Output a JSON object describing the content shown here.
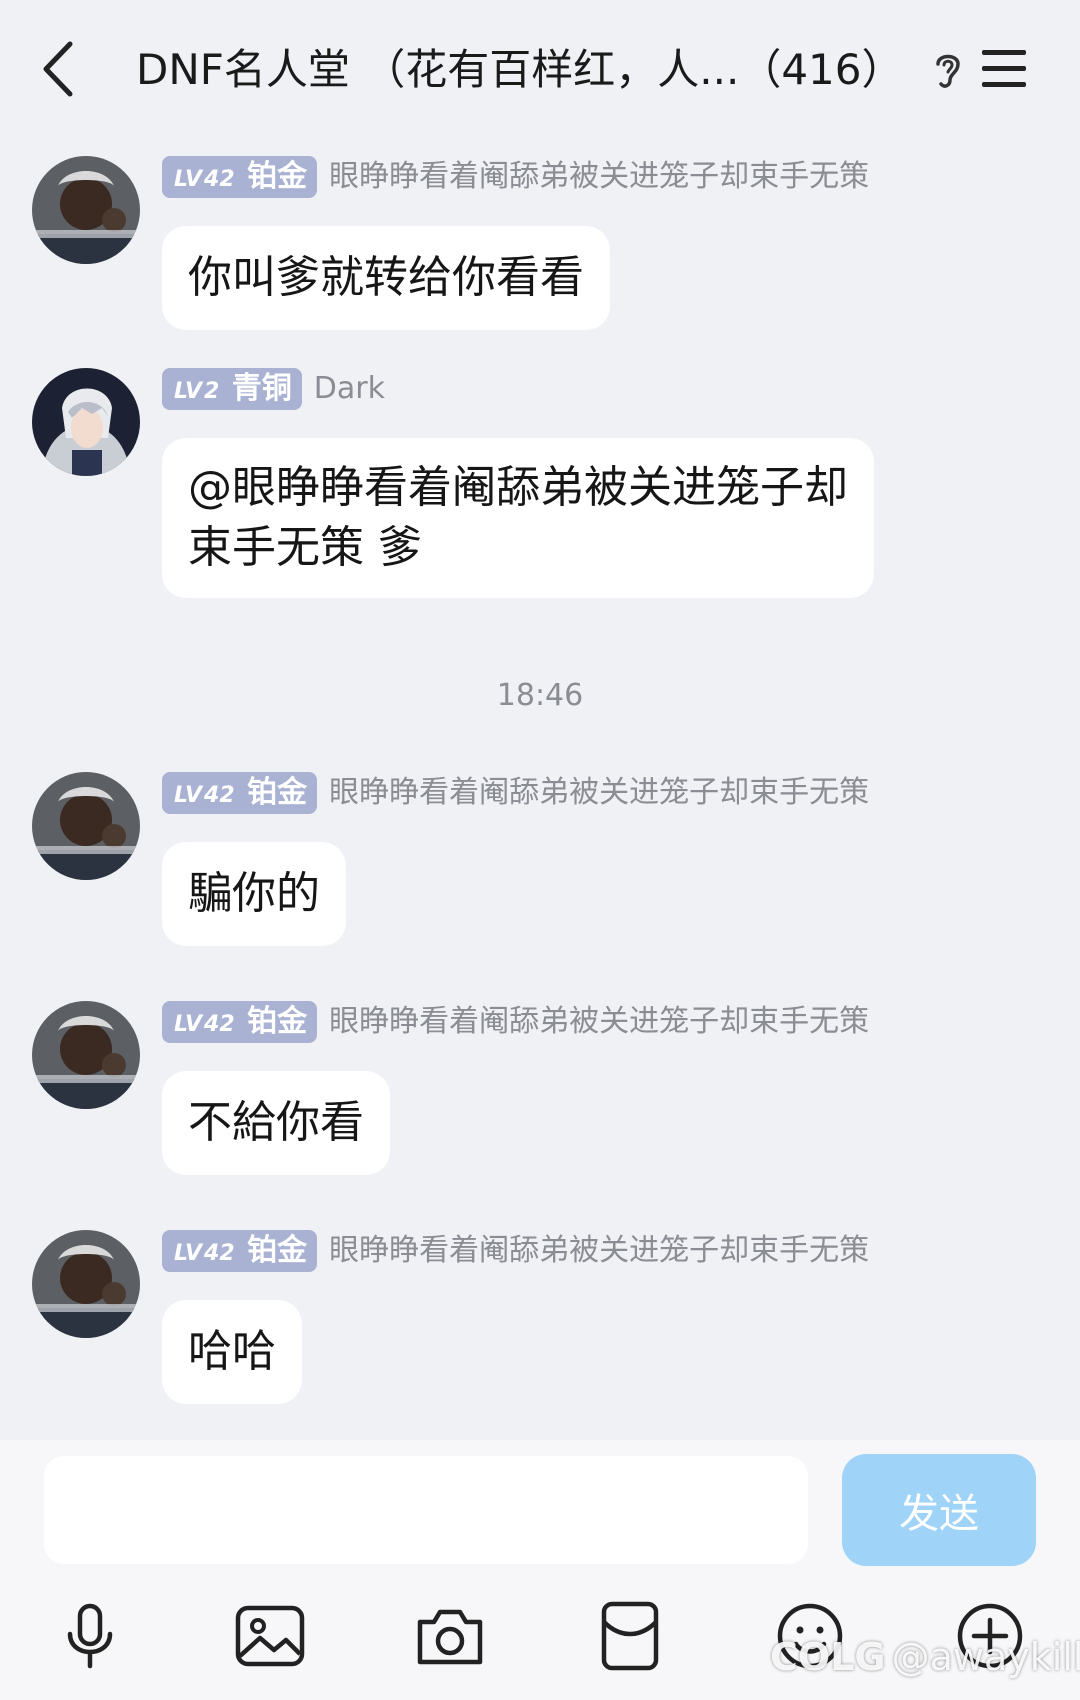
{
  "header": {
    "title": "DNF名人堂 （花有百样红，人...（416）",
    "back_icon": "chevron-left-icon",
    "ear_icon": "ear-icon",
    "menu_icon": "hamburger-menu-icon"
  },
  "messages": [
    {
      "level": "42",
      "rank": "铂金",
      "sender": "眼睁睁看着阉舔弟被关进笼子却束手无策",
      "text": "你叫爹就转给你看看"
    },
    {
      "level": "2",
      "rank": "青铜",
      "sender": "Dark",
      "text_line1": "@眼睁睁看着阉舔弟被关进笼子却",
      "text_line2": "束手无策 爹"
    },
    {
      "level": "42",
      "rank": "铂金",
      "sender": "眼睁睁看着阉舔弟被关进笼子却束手无策",
      "text": "騙你的"
    },
    {
      "level": "42",
      "rank": "铂金",
      "sender": "眼睁睁看着阉舔弟被关进笼子却束手无策",
      "text": "不給你看"
    },
    {
      "level": "42",
      "rank": "铂金",
      "sender": "眼睁睁看着阉舔弟被关进笼子却束手无策",
      "text": "哈哈"
    }
  ],
  "timestamp": "18:46",
  "lv_prefix": "LV",
  "composer": {
    "placeholder": "",
    "send_label": "发送"
  },
  "toolbar": [
    "microphone-icon",
    "image-icon",
    "camera-icon",
    "red-packet-icon",
    "emoji-icon",
    "plus-icon"
  ],
  "watermark": {
    "brand": "COLG",
    "handle": "@awaykill"
  },
  "colors": {
    "background": "#f0f1f4",
    "badge": "#a9b2d3",
    "send_button": "#9fd3f8",
    "bubble": "#ffffff"
  }
}
